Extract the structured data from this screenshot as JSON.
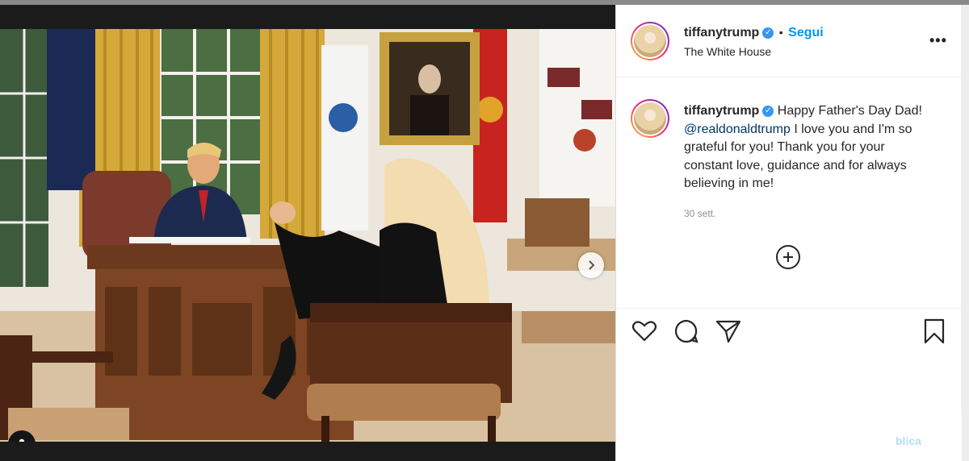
{
  "post": {
    "username": "tiffanytrump",
    "separator": "•",
    "follow_label": "Segui",
    "location": "The White House",
    "more_label": "•••",
    "verified_label": "✓",
    "caption_username": "tiffanytrump",
    "caption_before": "Happy Father's Day Dad! ",
    "caption_mention": "@realdonaldtrump",
    "caption_after": " I love you and I'm so grateful for you! Thank you for your constant love, guidance and for always believing in me!",
    "time": "30 sett.",
    "publish_label": "blica"
  },
  "icons": {
    "like": "heart-icon",
    "comment": "comment-icon",
    "share": "paper-plane-icon",
    "save": "bookmark-icon",
    "add": "plus-circle-icon",
    "next": "chevron-right-icon",
    "tag": "user-tag-icon"
  },
  "carousel": {
    "slides": 3,
    "active": 0
  },
  "colors": {
    "accent": "#0095f6",
    "verified": "#3897f0",
    "text": "#262626",
    "muted": "#8e8e8e"
  }
}
